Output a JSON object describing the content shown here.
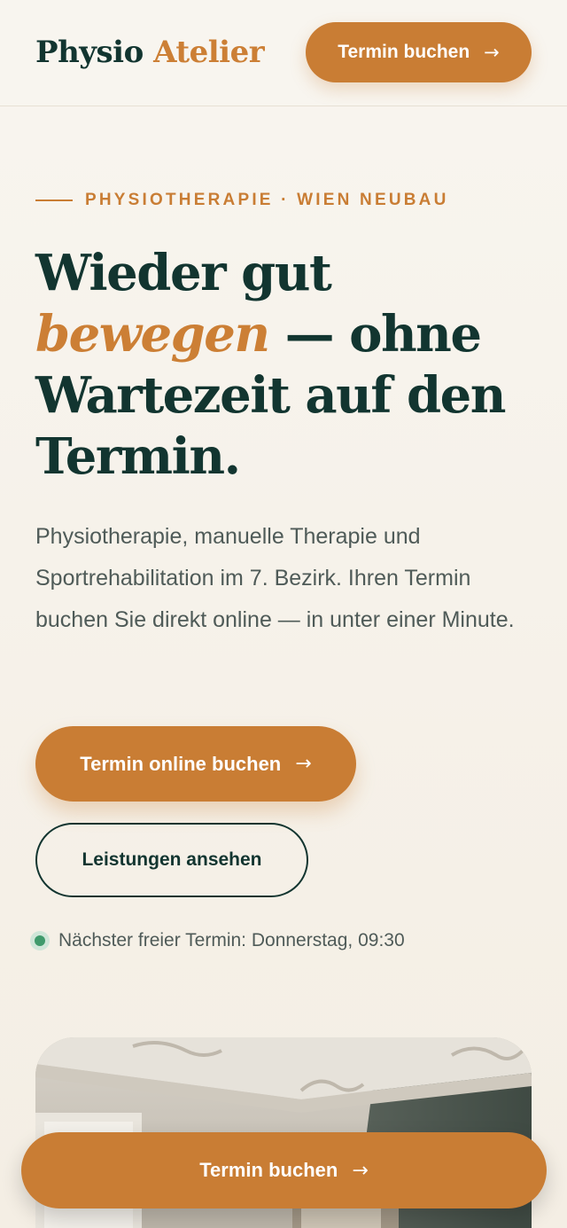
{
  "header": {
    "brand_first": "Physio",
    "brand_second": "Atelier",
    "cta_label": "Termin buchen",
    "cta_arrow": "→"
  },
  "hero": {
    "eyebrow": "PHYSIOTHERAPIE · WIEN NEUBAU",
    "headline_line1": "Wieder gut",
    "headline_accent": "bewegen",
    "headline_rest_line2": " — ohne",
    "headline_line3": "Wartezeit auf den",
    "headline_line4": "Termin.",
    "lead": "Physiotherapie, manuelle Therapie und Sportrehabilitation im 7. Bezirk. Ihren Termin buchen Sie direkt online — in unter einer Minute.",
    "primary_cta": "Termin online buchen",
    "primary_arrow": "→",
    "secondary_cta": "Leistungen ansehen",
    "availability": "Nächster freier Termin: Donnerstag, 09:30"
  },
  "sticky": {
    "cta_label": "Termin buchen",
    "cta_arrow": "→"
  },
  "colors": {
    "accent": "#c97d34",
    "text_dark": "#123530",
    "background": "#f8f5ef",
    "status_green": "#3f9a6b"
  },
  "icons": {
    "arrow": "arrow-right-icon",
    "status": "status-dot-icon"
  }
}
